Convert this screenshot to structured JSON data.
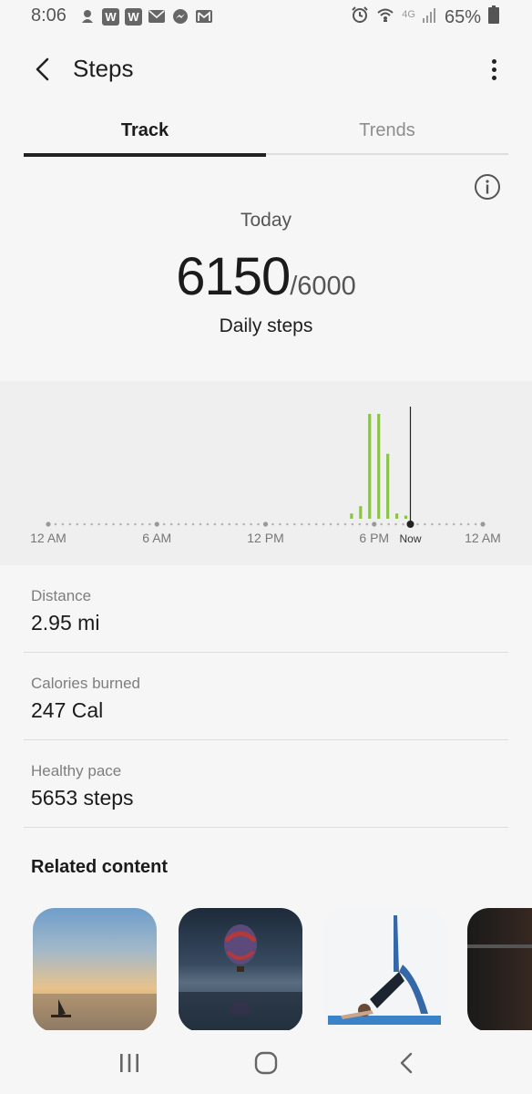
{
  "status_bar": {
    "time": "8:06",
    "battery": "65%",
    "network": "4G",
    "left_icons": [
      "wish-icon",
      "w-app-icon",
      "w-app-icon",
      "email-icon",
      "messenger-icon",
      "gmail-icon"
    ],
    "right_icons": [
      "alarm-icon",
      "wifi-icon",
      "signal-icon",
      "battery-icon"
    ]
  },
  "header": {
    "title": "Steps",
    "back_icon": "back-arrow-icon",
    "more_icon": "more-vert-icon"
  },
  "tabs": [
    {
      "label": "Track",
      "active": true
    },
    {
      "label": "Trends",
      "active": false
    }
  ],
  "summary": {
    "period": "Today",
    "steps": "6150",
    "goal": "/6000",
    "label": "Daily steps",
    "info_icon": "info-icon"
  },
  "chart_data": {
    "type": "bar",
    "title": "",
    "x_tick_labels": [
      "12 AM",
      "6 AM",
      "12 PM",
      "6 PM",
      "12 AM"
    ],
    "now_label": "Now",
    "now_hour": 20.0,
    "bars": [
      {
        "hour": 16.75,
        "value": 5
      },
      {
        "hour": 17.25,
        "value": 12
      },
      {
        "hour": 17.75,
        "value": 100
      },
      {
        "hour": 18.25,
        "value": 100
      },
      {
        "hour": 18.75,
        "value": 62
      },
      {
        "hour": 19.25,
        "value": 5
      },
      {
        "hour": 19.75,
        "value": 3
      }
    ],
    "colors": {
      "bar": "#8bc34a",
      "now_line": "#222222",
      "dots": "#b5b5b5"
    }
  },
  "metrics": [
    {
      "label": "Distance",
      "value": "2.95 mi"
    },
    {
      "label": "Calories burned",
      "value": "247 Cal"
    },
    {
      "label": "Healthy pace",
      "value": "5653 steps"
    }
  ],
  "related": {
    "title": "Related content",
    "cards": [
      {
        "name": "sunset-sea-card"
      },
      {
        "name": "hot-air-balloon-card"
      },
      {
        "name": "yoga-bridge-card"
      },
      {
        "name": "fitness-man-card"
      }
    ]
  },
  "nav_bar": {
    "buttons": [
      "recent-apps-icon",
      "home-icon",
      "back-icon"
    ]
  }
}
